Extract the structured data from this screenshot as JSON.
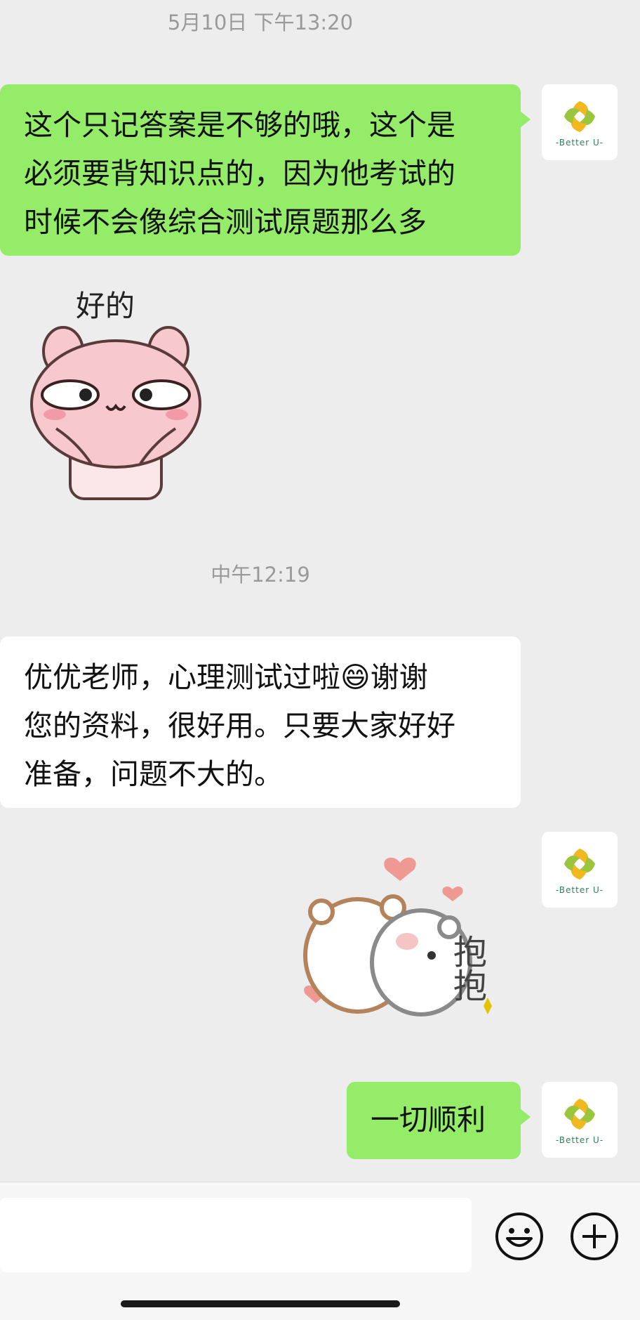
{
  "messages": {
    "timestamp_1": "5月10日 下午13:20",
    "bubble_1": "这个只记答案是不够的哦，这个是\n必须要背知识点的，因为他考试的\n时候不会像综合测试原题那么多",
    "sticker_1_text": "好的",
    "timestamp_2": "中午12:19",
    "bubble_2_part1": "优优老师，心理测试过啦",
    "bubble_2_emoji": "😄",
    "bubble_2_part2": "谢谢\n您的资料，很好用。只要大家好好\n准备，问题不大的。",
    "sticker_2_text": "抱抱",
    "bubble_3": "一切顺利"
  },
  "avatar": {
    "caption": "-Better U-",
    "icon": "better-u-logo-icon"
  },
  "input_bar": {
    "emoji_icon": "smiley-face-icon",
    "plus_icon": "plus-icon"
  },
  "colors": {
    "background": "#ededed",
    "my_bubble": "#95ec69",
    "their_bubble": "#ffffff",
    "timestamp_text": "#9a9a9a",
    "sticker_pink": "#f7c9cf"
  }
}
